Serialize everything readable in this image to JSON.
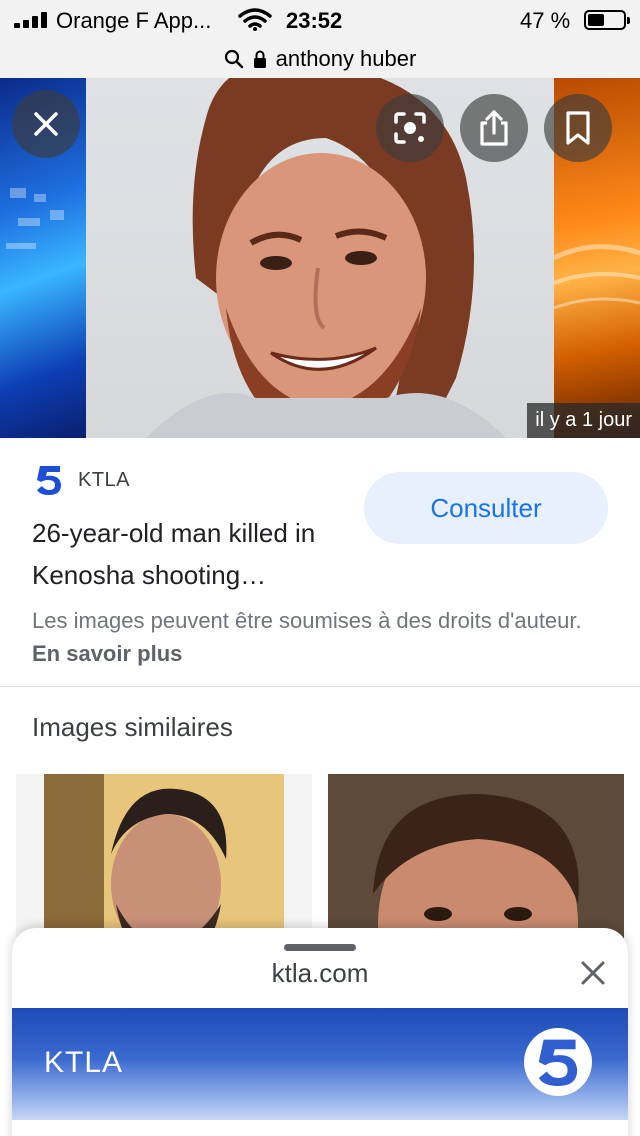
{
  "status_bar": {
    "carrier": "Orange F App...",
    "time": "23:52",
    "battery_percent": "47 %",
    "battery_level": 0.47
  },
  "url_bar": {
    "url": "anthony huber"
  },
  "hero": {
    "timestamp": "il y a 1 jour"
  },
  "result": {
    "source": "KTLA",
    "title": "26-year-old man killed in Kenosha shooting…",
    "consult_label": "Consulter",
    "rights_text": "Les images peuvent être soumises à des droits d'auteur.",
    "rights_link": "En savoir plus"
  },
  "similar": {
    "heading": "Images similaires"
  },
  "sheet": {
    "domain": "ktla.com",
    "banner_title": "KTLA"
  },
  "colors": {
    "accent": "#1a73e8",
    "consult_bg": "#e8f0fe",
    "ktla_blue": "#1d4bb8"
  },
  "icons": [
    "search-icon",
    "lock-icon",
    "close-icon",
    "lens-icon",
    "share-icon",
    "bookmark-icon",
    "wifi-icon",
    "ktla-logo-icon"
  ]
}
